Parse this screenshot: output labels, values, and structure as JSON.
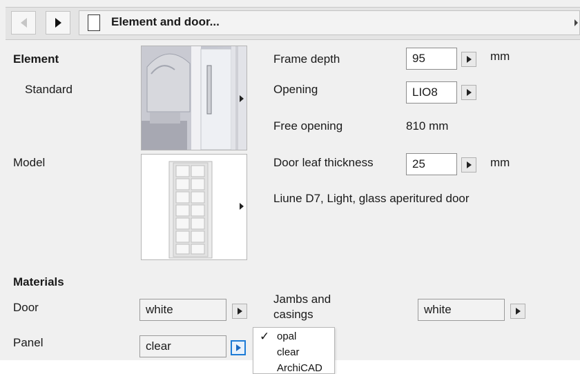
{
  "header": {
    "back_arrow": "arrow-left-icon",
    "forward_arrow": "arrow-right-icon",
    "title": "Element and door..."
  },
  "element": {
    "heading": "Element",
    "value": "Standard",
    "model_label": "Model"
  },
  "dimensions": {
    "frame_depth_label": "Frame depth",
    "frame_depth_value": "95",
    "frame_depth_unit": "mm",
    "opening_label": "Opening",
    "opening_value": "LIO8",
    "free_opening_label": "Free opening",
    "free_opening_value": "810 mm",
    "door_leaf_thickness_label": "Door leaf thickness",
    "door_leaf_thickness_value": "25",
    "door_leaf_thickness_unit": "mm",
    "description": "Liune D7, Light, glass aperitured door"
  },
  "materials": {
    "heading": "Materials",
    "door_label": "Door",
    "door_value": "white",
    "jambs_label_line1": "Jambs and",
    "jambs_label_line2": "casings",
    "jambs_value": "white",
    "panel_label": "Panel",
    "panel_value": "clear"
  },
  "panel_dropdown": {
    "options": [
      "opal",
      "clear",
      "ArchiCAD"
    ],
    "checked_option": "opal"
  },
  "colors": {
    "accent": "#1c7bd6",
    "panel_background": "#f0f0f0"
  }
}
